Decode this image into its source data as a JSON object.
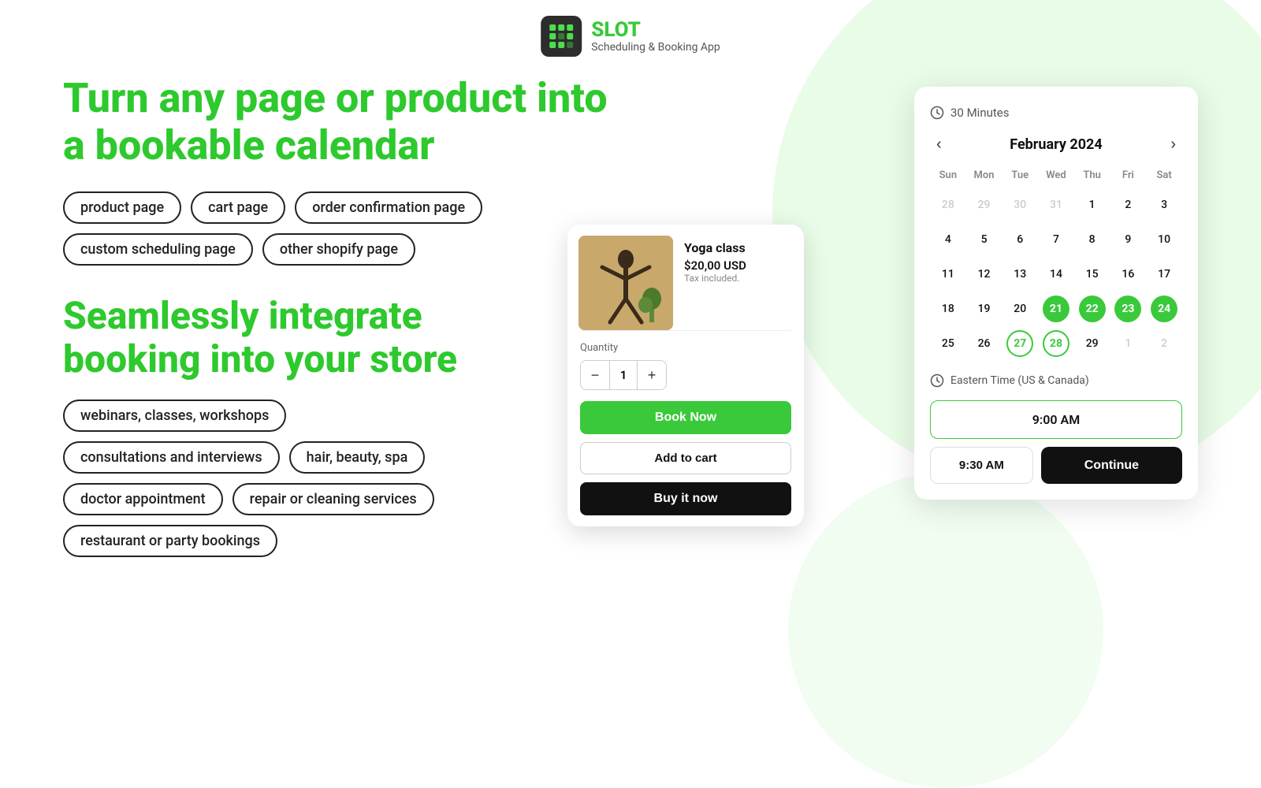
{
  "app": {
    "logo_title": "SLOT",
    "logo_subtitle": "Scheduling & Booking App"
  },
  "headline1": "Turn any page or product into",
  "headline2": "a bookable calendar",
  "tags_row1": [
    "product page",
    "cart page",
    "order confirmation page"
  ],
  "tags_row2": [
    "custom scheduling page",
    "other shopify page"
  ],
  "headline3": "Seamlessly integrate",
  "headline4": "booking into your store",
  "use_cases_row1": [
    "webinars, classes, workshops"
  ],
  "use_cases_row2": [
    "consultations and interviews",
    "hair, beauty, spa"
  ],
  "use_cases_row3": [
    "doctor appointment",
    "repair or cleaning services"
  ],
  "use_cases_row4": [
    "restaurant or party bookings"
  ],
  "product_card": {
    "name": "Yoga class",
    "price": "$20,00 USD",
    "tax": "Tax included.",
    "quantity_label": "Quantity",
    "quantity_value": "1",
    "btn_book": "Book Now",
    "btn_add_cart": "Add to cart",
    "btn_buy": "Buy it now"
  },
  "calendar": {
    "duration": "30 Minutes",
    "month": "February 2024",
    "days_of_week": [
      "Sun",
      "Mon",
      "Tue",
      "Wed",
      "Thu",
      "Fri",
      "Sat"
    ],
    "weeks": [
      [
        {
          "day": "28",
          "type": "other-month"
        },
        {
          "day": "29",
          "type": "other-month"
        },
        {
          "day": "30",
          "type": "other-month"
        },
        {
          "day": "31",
          "type": "other-month"
        },
        {
          "day": "1",
          "type": "normal"
        },
        {
          "day": "2",
          "type": "normal"
        },
        {
          "day": "3",
          "type": "normal"
        }
      ],
      [
        {
          "day": "4",
          "type": "normal"
        },
        {
          "day": "5",
          "type": "normal"
        },
        {
          "day": "6",
          "type": "normal"
        },
        {
          "day": "7",
          "type": "normal"
        },
        {
          "day": "8",
          "type": "normal"
        },
        {
          "day": "9",
          "type": "normal"
        },
        {
          "day": "10",
          "type": "normal"
        }
      ],
      [
        {
          "day": "11",
          "type": "normal"
        },
        {
          "day": "12",
          "type": "normal"
        },
        {
          "day": "13",
          "type": "normal"
        },
        {
          "day": "14",
          "type": "normal"
        },
        {
          "day": "15",
          "type": "normal"
        },
        {
          "day": "16",
          "type": "normal"
        },
        {
          "day": "17",
          "type": "normal"
        }
      ],
      [
        {
          "day": "18",
          "type": "normal"
        },
        {
          "day": "19",
          "type": "normal"
        },
        {
          "day": "20",
          "type": "normal"
        },
        {
          "day": "21",
          "type": "selected"
        },
        {
          "day": "22",
          "type": "selected"
        },
        {
          "day": "23",
          "type": "selected"
        },
        {
          "day": "24",
          "type": "selected"
        }
      ],
      [
        {
          "day": "25",
          "type": "normal"
        },
        {
          "day": "26",
          "type": "normal"
        },
        {
          "day": "27",
          "type": "selected-outline"
        },
        {
          "day": "28",
          "type": "selected-outline"
        },
        {
          "day": "29",
          "type": "normal"
        },
        {
          "day": "1",
          "type": "other-month"
        },
        {
          "day": "2",
          "type": "other-month"
        }
      ]
    ],
    "timezone": "Eastern Time (US & Canada)",
    "time_slot_1": "9:00 AM",
    "time_slot_2": "9:30 AM",
    "btn_continue": "Continue"
  }
}
